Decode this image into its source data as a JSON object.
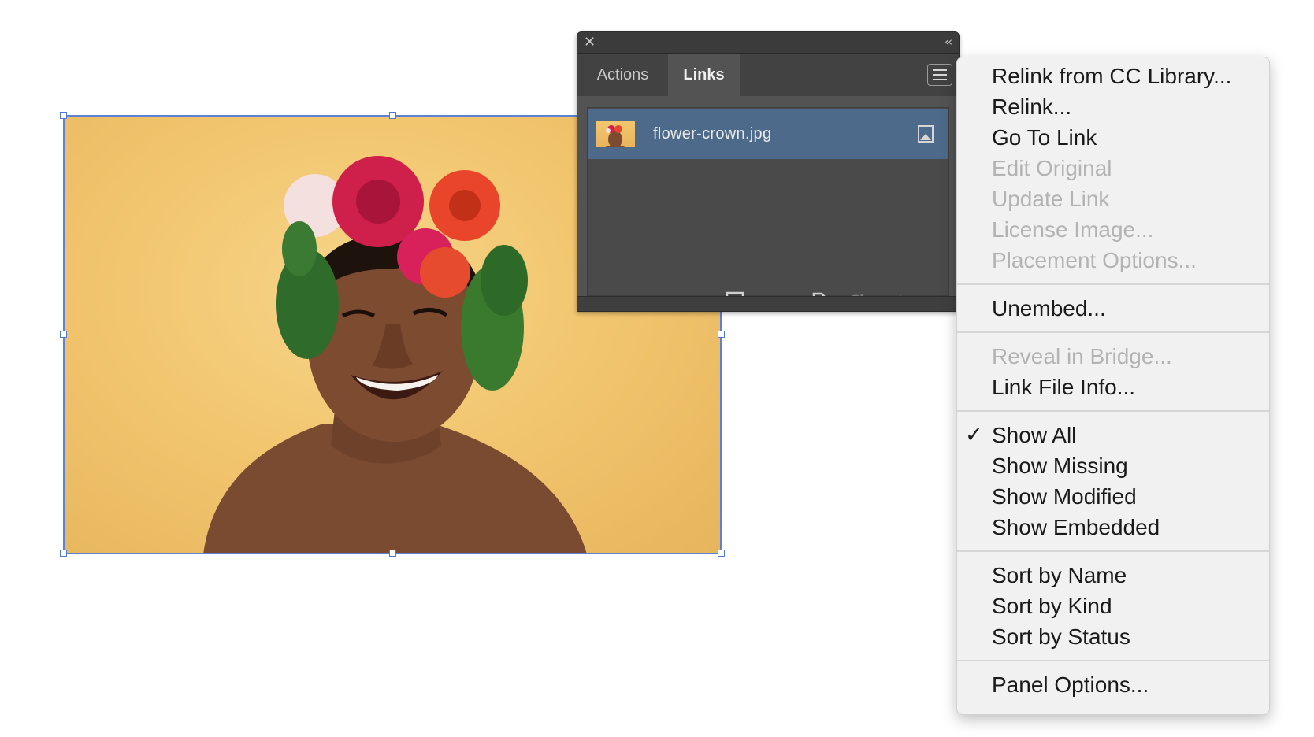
{
  "canvas": {
    "image_description_icon": "portrait-photo"
  },
  "panel": {
    "close_icon": "✕",
    "collapse_icon": "‹‹",
    "tabs": [
      {
        "label": "Actions",
        "active": false
      },
      {
        "label": "Links",
        "active": true
      }
    ],
    "links": [
      {
        "name": "flower-crown.jpg",
        "status_icon": "embedded-icon"
      }
    ],
    "footer_icons": [
      "relink-from-cc-icon",
      "relink-icon",
      "go-to-link-icon",
      "update-link-icon",
      "edit-original-icon"
    ]
  },
  "menu": {
    "groups": [
      [
        {
          "label": "Relink from CC Library...",
          "enabled": true
        },
        {
          "label": "Relink...",
          "enabled": true
        },
        {
          "label": "Go To Link",
          "enabled": true
        },
        {
          "label": "Edit Original",
          "enabled": false
        },
        {
          "label": "Update Link",
          "enabled": false
        },
        {
          "label": "License Image...",
          "enabled": false
        },
        {
          "label": "Placement Options...",
          "enabled": false
        }
      ],
      [
        {
          "label": "Unembed...",
          "enabled": true
        }
      ],
      [
        {
          "label": "Reveal in Bridge...",
          "enabled": false
        },
        {
          "label": "Link File Info...",
          "enabled": true
        }
      ],
      [
        {
          "label": "Show All",
          "enabled": true,
          "checked": true
        },
        {
          "label": "Show Missing",
          "enabled": true
        },
        {
          "label": "Show Modified",
          "enabled": true
        },
        {
          "label": "Show Embedded",
          "enabled": true
        }
      ],
      [
        {
          "label": "Sort by Name",
          "enabled": true
        },
        {
          "label": "Sort by Kind",
          "enabled": true
        },
        {
          "label": "Sort by Status",
          "enabled": true
        }
      ],
      [
        {
          "label": "Panel Options...",
          "enabled": true
        }
      ]
    ],
    "check_glyph": "✓"
  },
  "colors": {
    "selection": "#5b82d6",
    "panel_bg": "#535353",
    "link_row_selected": "#4d6a8a",
    "menu_bg": "#f1f1f1",
    "menu_disabled": "#b3b3b3"
  }
}
